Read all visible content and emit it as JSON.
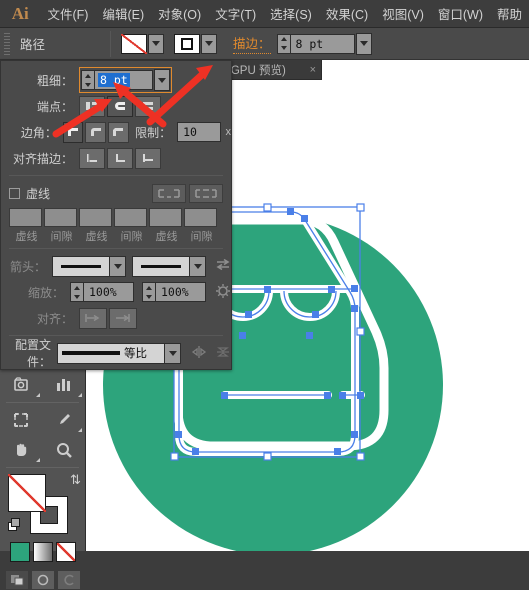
{
  "app": {
    "logo": "Ai"
  },
  "menubar": {
    "items": [
      {
        "label": "文件(F)"
      },
      {
        "label": "编辑(E)"
      },
      {
        "label": "对象(O)"
      },
      {
        "label": "文字(T)"
      },
      {
        "label": "选择(S)"
      },
      {
        "label": "效果(C)"
      },
      {
        "label": "视图(V)"
      },
      {
        "label": "窗口(W)"
      },
      {
        "label": "帮助"
      }
    ]
  },
  "controlbar": {
    "object_label": "路径",
    "fill_swatch": "none",
    "stroke_swatch": "square",
    "stroke_link_label": "描边：",
    "stroke_weight_value": "8 pt"
  },
  "document_tab": {
    "title": "(GPU 预览)",
    "close_label": "×"
  },
  "stroke_panel": {
    "weight": {
      "label": "粗细：",
      "value": "8 pt",
      "selected_text": "8 pt"
    },
    "cap": {
      "label": "端点：",
      "options": [
        "平头端点",
        "圆头端点",
        "方头端点"
      ],
      "selected_index": 1
    },
    "corner": {
      "label": "边角：",
      "options": [
        "斜接连接",
        "圆角连接",
        "斜角连接"
      ],
      "selected_index": 0,
      "limit_label": "限制：",
      "limit_value": "10",
      "limit_unit": "x"
    },
    "align": {
      "label": "对齐描边：",
      "options": [
        "使描边居中对齐",
        "使描边内侧对齐",
        "使描边外侧对齐"
      ],
      "selected_index": -1
    },
    "dashed": {
      "checkbox_label": "虚线",
      "checked": false,
      "cap_buttons": [
        "保留虚线和间隙的精确长度",
        "使虚线与边角和路径终端对齐"
      ],
      "fields": [
        "",
        "",
        "",
        "",
        "",
        ""
      ],
      "captions": [
        "虚线",
        "间隙",
        "虚线",
        "间隙",
        "虚线",
        "间隙"
      ]
    },
    "arrowheads": {
      "label": "箭头：",
      "start_value": "无",
      "end_value": "无",
      "swap_label": "互换箭头起始处和结束处"
    },
    "scale": {
      "label": "缩放：",
      "start_value": "100%",
      "end_value": "100%",
      "link_label": "链接箭头头部和尾部缩放"
    },
    "align_row": {
      "label": "对齐：",
      "options": [
        "将箭头提示扩展到路径终点外",
        "将箭头提示放置于路径终点处"
      ]
    },
    "profile": {
      "label": "配置文件：",
      "value": "等比",
      "flip_across_label": "横向翻转",
      "flip_along_label": "纵向翻转"
    }
  },
  "tools": {
    "rows": [
      [
        {
          "name": "artboard-tool",
          "icon": "artboard"
        },
        {
          "name": "graph-tool",
          "icon": "graph"
        }
      ],
      [
        {
          "name": "slice-tool",
          "icon": "slice"
        },
        {
          "name": "eyedropper-tool",
          "icon": "eyedropper"
        }
      ],
      [
        {
          "name": "hand-tool",
          "icon": "hand"
        },
        {
          "name": "zoom-tool",
          "icon": "zoom"
        }
      ]
    ],
    "fill_color": "none",
    "stroke_color": "none",
    "color_modes": [
      {
        "name": "color",
        "value": "#2da47c"
      },
      {
        "name": "gradient",
        "value": "gradient"
      },
      {
        "name": "none",
        "value": "none"
      }
    ],
    "draw_modes": [
      "正常绘图",
      "背面绘图",
      "内部绘图"
    ]
  },
  "canvas": {
    "artwork_name": "bag-icon-artwork",
    "circle_color": "#2da47c",
    "shape_stroke_color": "#ffffff",
    "selection_color": "#4a7fe8",
    "background": "#ffffff"
  },
  "annotations": {
    "arrow_color": "#ee3124",
    "arrows": [
      {
        "name": "arrow-to-stroke-link",
        "points_to": "描边："
      },
      {
        "name": "arrow-to-weight-field",
        "points_to": "粗细 输入框"
      },
      {
        "name": "arrow-to-cap-buttons",
        "points_to": "端点 按钮"
      }
    ]
  }
}
